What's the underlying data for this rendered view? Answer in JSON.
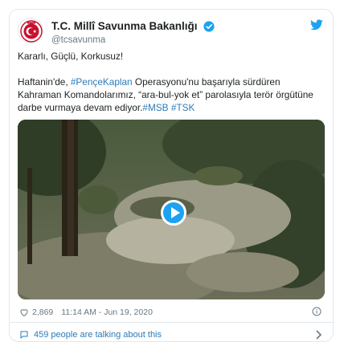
{
  "account": {
    "name": "T.C. Millî Savunma Bakanlığı",
    "handle": "@tcsavunma"
  },
  "tweet": {
    "line1": "Kararlı, Güçlü, Korkusuz!",
    "p2_a": "Haftanin'de, ",
    "p2_tag": "#PençeKaplan",
    "p2_b": " Operasyonu'nu başarıyla sürdüren Kahraman Komandolarımız, “ara-bul-yok et” parolasıyla terör örgütüne darbe vurmaya devam ediyor.",
    "tag_msb": "#MSB",
    "tag_tsk": "#TSK"
  },
  "meta": {
    "likes": "2,869",
    "timestamp": "11:14 AM - Jun 19, 2020"
  },
  "footer": {
    "talking": "459 people are talking about this"
  },
  "colors": {
    "link": "#2b7bb9",
    "twitter_blue": "#1da1f2",
    "muted": "#697882",
    "logo_red": "#c8102e"
  },
  "icons": {
    "verified": "verified-badge-icon",
    "bird": "twitter-bird-icon",
    "play": "play-icon",
    "like": "heart-icon",
    "info": "info-icon",
    "comments": "speech-bubble-icon",
    "chevron": "chevron-right-icon"
  }
}
